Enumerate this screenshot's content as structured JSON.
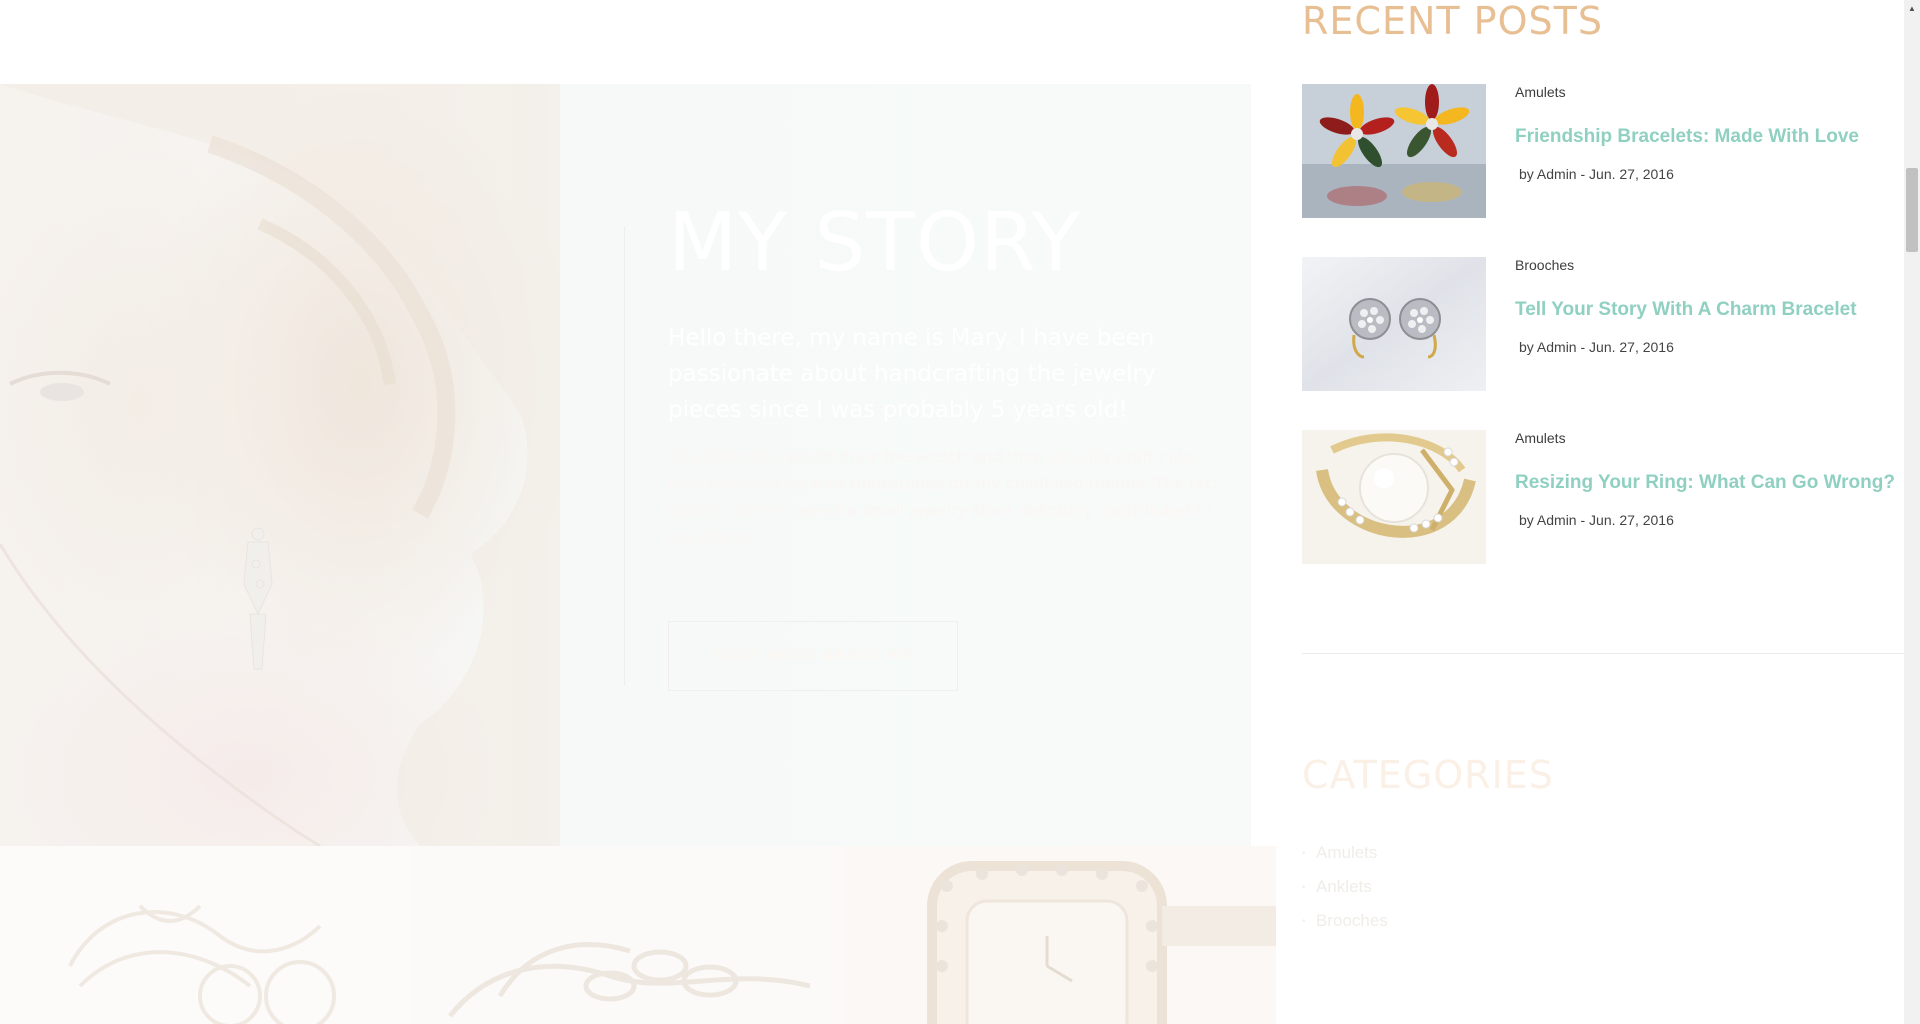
{
  "story": {
    "title": "MY STORY",
    "lead": "Hello there, my name is Mary. I have been passionate about handcrafting the jewelry pieces since I was probably 5 years old!",
    "body": "At a little girl I would draw the sketch and then actually craft cute little hair buckles with rhinestones for my childhood friends. The fact that my father owned a small jewelry store definitely contributed to my interest.",
    "button_label": "READ MORE ABOUT ME"
  },
  "sidebar": {
    "recent_title": "RECENT POSTS",
    "posts": [
      {
        "category": "Amulets",
        "title": "Friendship Bracelets: Made With Love",
        "meta": "by Admin - Jun. 27, 2016",
        "thumb": "colorful-gem-earrings"
      },
      {
        "category": "Brooches",
        "title": "Tell Your Story With A Charm Bracelet",
        "meta": "by Admin - Jun. 27, 2016",
        "thumb": "diamond-stud-earrings"
      },
      {
        "category": "Amulets",
        "title": "Resizing Your Ring: What Can Go Wrong?",
        "meta": "by Admin - Jun. 27, 2016",
        "thumb": "pearl-gold-ring"
      }
    ],
    "categories_title": "CATEGORIES",
    "categories": [
      "Amulets",
      "Anklets",
      "Brooches"
    ]
  },
  "colors": {
    "accent_heading": "#e8bf93",
    "post_title": "#8fd0c0",
    "text": "#3d3d3d"
  }
}
